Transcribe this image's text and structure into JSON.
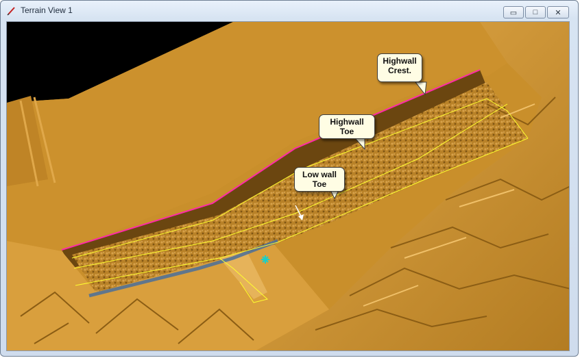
{
  "window": {
    "title": "Terrain View 1",
    "app_icon": "pencil-icon",
    "controls": {
      "minimize": "▭",
      "maximize": "□",
      "close": "✕"
    }
  },
  "colors": {
    "terrain": "#c98f2b",
    "terrain_light": "#e3aa49",
    "terrain_dark": "#8b5d14",
    "sky": "#000000",
    "crest_line": "#ff2aa8",
    "toe_line": "#ffff2e",
    "water": "#4a6e9a",
    "marker": "#18d0c8"
  },
  "labels": {
    "highwall_crest_line1": "Highwall",
    "highwall_crest_line2": "Crest.",
    "highwall_toe": "Highwall Toe",
    "lowwall_toe_line1": "Low wall",
    "lowwall_toe_line2": "Toe"
  }
}
